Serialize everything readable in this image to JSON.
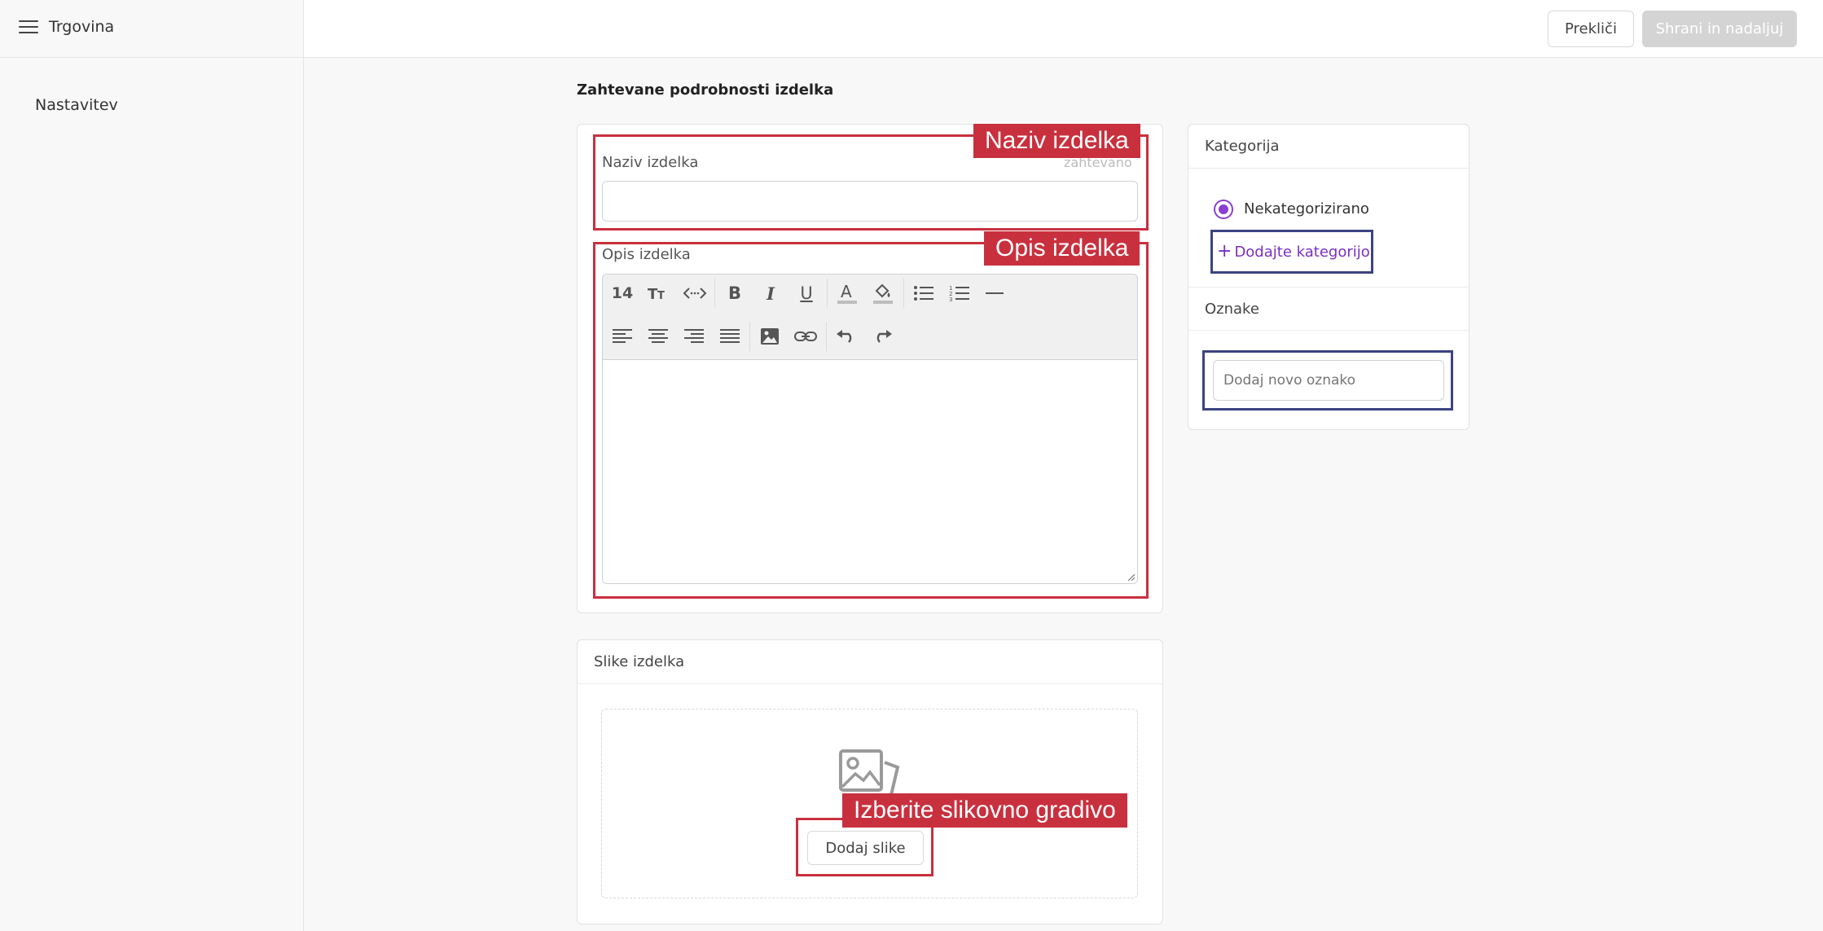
{
  "header": {
    "app_title": "Trgovina",
    "cancel_label": "Prekliči",
    "save_label": "Shrani in nadaljuj"
  },
  "sidebar": {
    "items": [
      {
        "label": "Nastavitev"
      }
    ]
  },
  "main": {
    "section_title": "Zahtevane podrobnosti izdelka",
    "name_field": {
      "label": "Naziv izdelka",
      "required_hint": "zahtevano",
      "value": ""
    },
    "description_field": {
      "label": "Opis izdelka",
      "font_size": "14",
      "value": ""
    },
    "images_card": {
      "title": "Slike izdelka",
      "add_button_label": "Dodaj slike"
    }
  },
  "side": {
    "category_title": "Kategorija",
    "category_option": "Nekategorizirano",
    "add_category_label": "Dodajte kategorijo",
    "tags_title": "Oznake",
    "tags_placeholder": "Dodaj novo oznako"
  },
  "annotations": {
    "name_tag": "Naziv izdelka",
    "description_tag": "Opis izdelka",
    "images_tag": "Izberite slikovno gradivo"
  },
  "colors": {
    "accent": "#8a3fd1",
    "annotation_red": "#c9303e",
    "annotation_blue": "#3b4481",
    "save_disabled": "#d4d4d4"
  }
}
